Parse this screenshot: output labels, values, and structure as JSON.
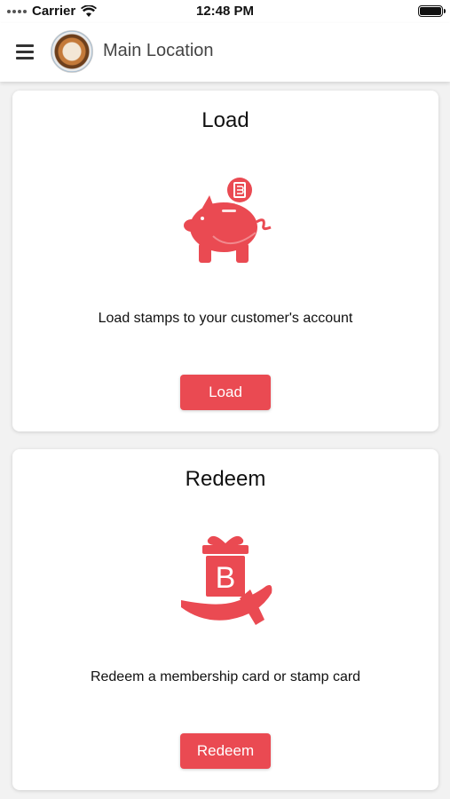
{
  "status_bar": {
    "carrier": "Carrier",
    "time": "12:48 PM",
    "icons": [
      "signal-icon",
      "wifi-icon",
      "battery-icon"
    ]
  },
  "header": {
    "title": "Main Location",
    "icons": [
      "menu-icon",
      "avatar"
    ]
  },
  "cards": {
    "load": {
      "title": "Load",
      "icon": "piggy-bank-icon",
      "description": "Load stamps to your customer's account",
      "button_label": "Load"
    },
    "redeem": {
      "title": "Redeem",
      "icon": "gift-hand-icon",
      "description": "Redeem a membership card or stamp card",
      "button_label": "Redeem"
    }
  },
  "colors": {
    "accent": "#ea4a52",
    "background": "#f2f2f2",
    "card": "#ffffff"
  }
}
